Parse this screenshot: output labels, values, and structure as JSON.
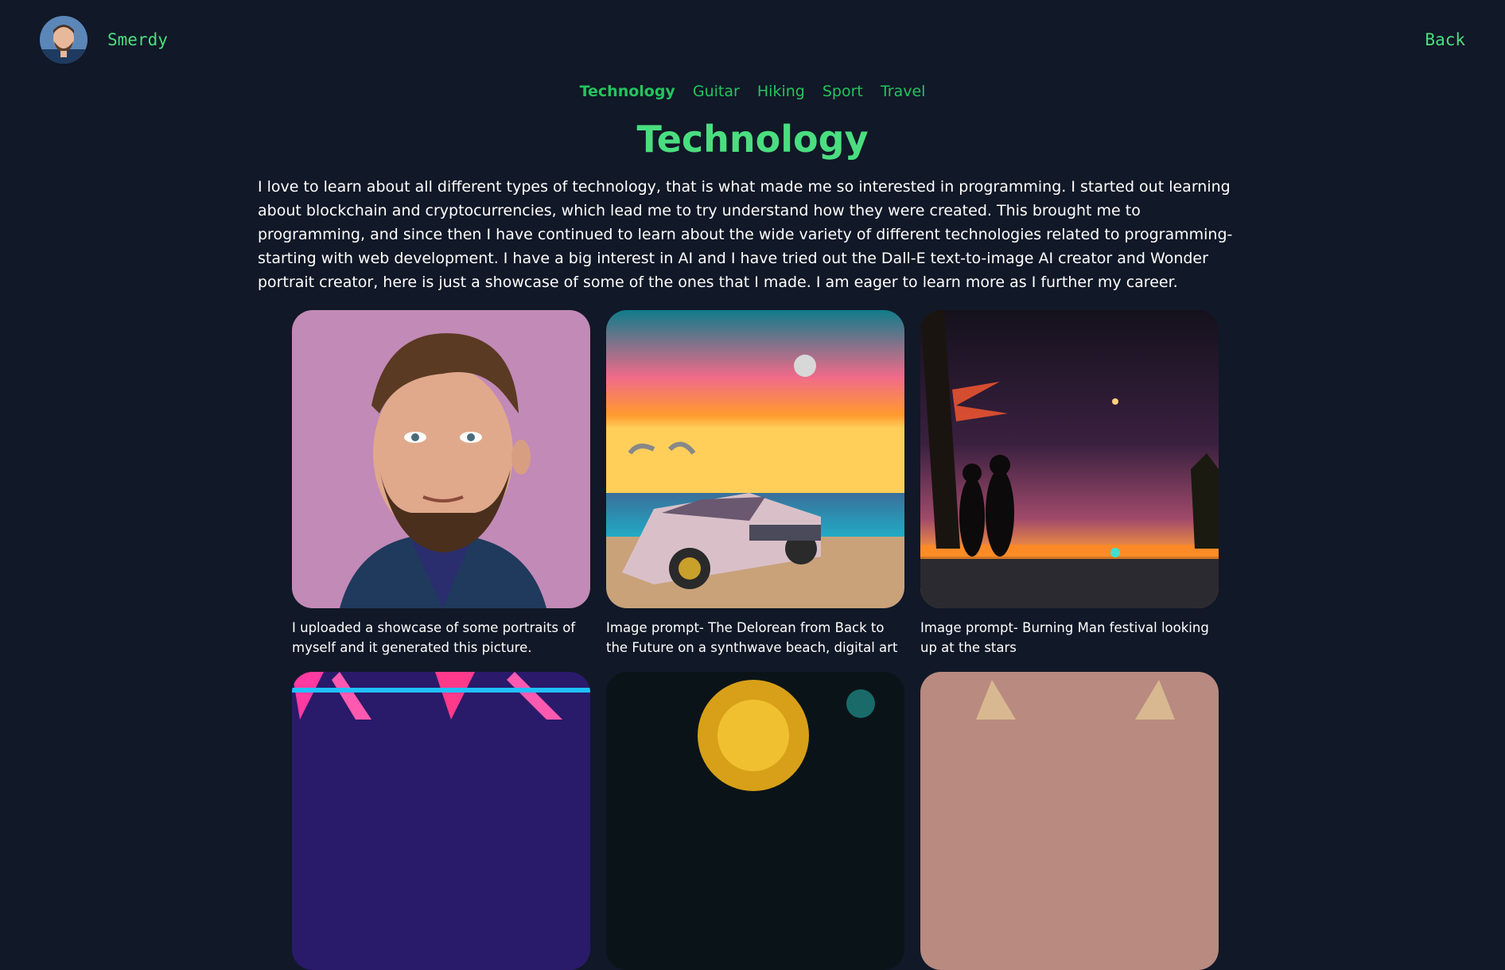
{
  "header": {
    "site_name": "Smerdy",
    "back_label": "Back"
  },
  "nav": {
    "tabs": [
      {
        "label": "Technology",
        "active": true
      },
      {
        "label": "Guitar",
        "active": false
      },
      {
        "label": "Hiking",
        "active": false
      },
      {
        "label": "Sport",
        "active": false
      },
      {
        "label": "Travel",
        "active": false
      }
    ]
  },
  "main": {
    "title": "Technology",
    "intro": "I love to learn about all different types of technology, that is what made me so interested in programming. I started out learning about blockchain and cryptocurrencies, which lead me to try understand how they were created. This brought me to programming, and since then I have continued to learn about the wide variety of different technologies related to programming- starting with web development. I have a big interest in AI and I have tried out the Dall-E text-to-image AI creator and Wonder portrait creator, here is just a showcase of some of the ones that I made. I am eager to learn more as I further my career.",
    "gallery": [
      {
        "caption": "I uploaded a showcase of some portraits of myself and it generated this picture.",
        "image": "portrait-image"
      },
      {
        "caption": "Image prompt- The Delorean from Back to the Future on a synthwave beach, digital art",
        "image": "delorean-beach-image"
      },
      {
        "caption": "Image prompt- Burning Man festival looking up at the stars",
        "image": "burning-man-image"
      },
      {
        "caption": "",
        "image": "neon-city-image"
      },
      {
        "caption": "",
        "image": "sun-space-image"
      },
      {
        "caption": "",
        "image": "cat-image"
      }
    ]
  },
  "colors": {
    "background": "#111827",
    "accent": "#4ade80",
    "text": "#ffffff"
  }
}
